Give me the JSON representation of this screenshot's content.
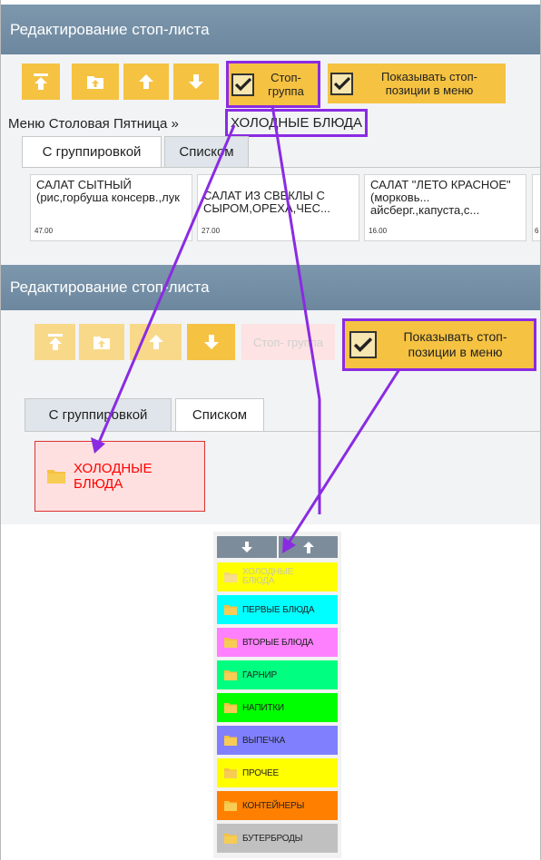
{
  "top_panel": {
    "title": "Редактирование стоп-листа",
    "stop_group_label": "Стоп-\nгруппа",
    "show_stop_label": "Показывать стоп-\nпозиции в меню",
    "breadcrumb_prefix": "Меню Столовая Пятница »",
    "breadcrumb_current": "ХОЛОДНЫЕ БЛЮДА",
    "tabs": [
      "С группировкой",
      "Списком"
    ],
    "cards": [
      {
        "name": "САЛАТ СЫТНЫЙ (рис,горбуша консерв.,лук",
        "price": "47.00"
      },
      {
        "name": "САЛАТ ИЗ СВЕКЛЫ С СЫРОМ,ОРЕХА,ЧЕС...",
        "price": "27.00"
      },
      {
        "name": "САЛАТ \"ЛЕТО КРАСНОЕ\"(морковь... айсберг.,капуста,с...",
        "price": "16.00"
      }
    ],
    "cut_price": "6"
  },
  "bottom_panel": {
    "title": "Редактирование стоп-листа",
    "stop_group_label": "Стоп- группа",
    "show_stop_label": "Показывать стоп-\nпозиции в меню",
    "tabs": [
      "С группировкой",
      "Списком"
    ],
    "group_tile": "ХОЛОДНЫЕ\nБЛЮДА"
  },
  "categories": [
    {
      "label": "ХОЛОДНЫЕ\nБЛЮДА",
      "color": "#ffff00",
      "muted": true
    },
    {
      "label": "ПЕРВЫЕ БЛЮДА",
      "color": "#00ffff"
    },
    {
      "label": "ВТОРЫЕ БЛЮДА",
      "color": "#ff80ff"
    },
    {
      "label": "ГАРНИР",
      "color": "#00ff80"
    },
    {
      "label": "НАПИТКИ",
      "color": "#00ff00"
    },
    {
      "label": "ВЫПЕЧКА",
      "color": "#8080ff"
    },
    {
      "label": "ПРОЧЕЕ",
      "color": "#ffff00"
    },
    {
      "label": "КОНТЕЙНЕРЫ",
      "color": "#ff8000"
    },
    {
      "label": "БУТЕРБРОДЫ",
      "color": "#c0c0c0"
    }
  ],
  "colors": {
    "accent": "#f5c242",
    "titlebar": "#6f8aa1",
    "highlight": "#8a2be2",
    "stop_tile_bg": "#ffe0e0",
    "stop_tile_text": "#ff0000"
  }
}
